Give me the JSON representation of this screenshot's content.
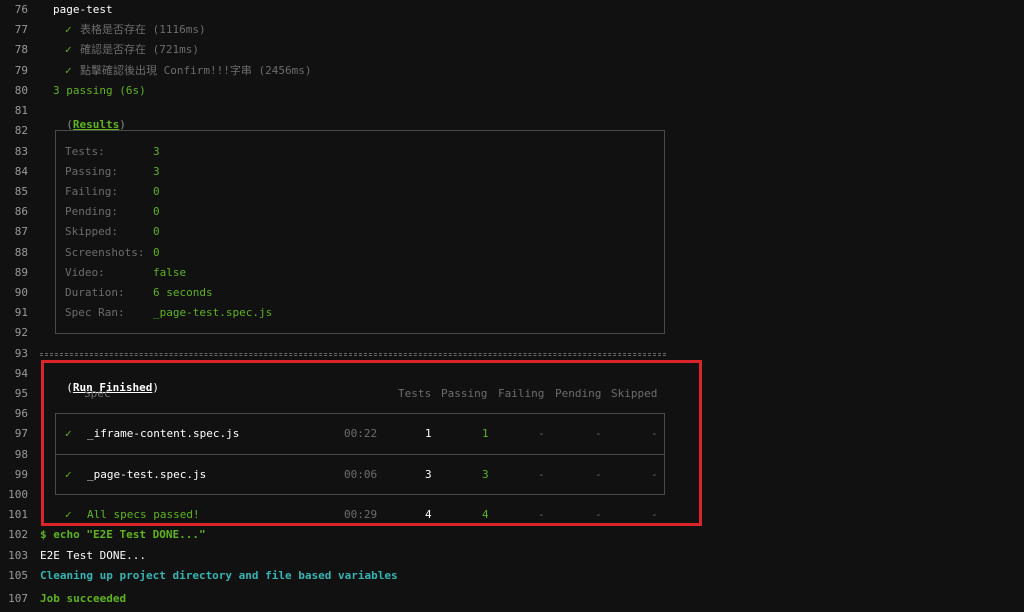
{
  "lines": {
    "76": {
      "num": "76",
      "text": "page-test"
    },
    "77": {
      "num": "77",
      "check": "✓",
      "text": "表格是否存在 (1116ms)"
    },
    "78": {
      "num": "78",
      "check": "✓",
      "text": "確認是否存在 (721ms)"
    },
    "79": {
      "num": "79",
      "check": "✓",
      "text": "點擊確認後出現 Confirm!!!字串 (2456ms)"
    },
    "80": {
      "num": "80",
      "text": "3 passing (6s)"
    },
    "81": {
      "num": "81",
      "text_open": "(",
      "text": "Results",
      "text_close": ")"
    },
    "82": {
      "num": "82"
    },
    "83": {
      "num": "83",
      "label": "Tests:",
      "value": "3"
    },
    "84": {
      "num": "84",
      "label": "Passing:",
      "value": "3"
    },
    "85": {
      "num": "85",
      "label": "Failing:",
      "value": "0"
    },
    "86": {
      "num": "86",
      "label": "Pending:",
      "value": "0"
    },
    "87": {
      "num": "87",
      "label": "Skipped:",
      "value": "0"
    },
    "88": {
      "num": "88",
      "label": "Screenshots:",
      "value": "0"
    },
    "89": {
      "num": "89",
      "label": "Video:",
      "value": "false"
    },
    "90": {
      "num": "90",
      "label": "Duration:",
      "value": "6 seconds"
    },
    "91": {
      "num": "91",
      "label": "Spec Ran:",
      "value": "_page-test.spec.js"
    },
    "92": {
      "num": "92"
    },
    "93": {
      "num": "93"
    },
    "94": {
      "num": "94",
      "text_open": "(",
      "text": "Run Finished",
      "text_close": ")"
    },
    "95": {
      "num": "95",
      "spec": "Spec",
      "tests": "Tests",
      "passing": "Passing",
      "failing": "Failing",
      "pending": "Pending",
      "skipped": "Skipped"
    },
    "96": {
      "num": "96"
    },
    "97": {
      "num": "97",
      "check": "✓",
      "spec": "_iframe-content.spec.js",
      "time": "00:22",
      "tests": "1",
      "passing": "1",
      "failing": "-",
      "pending": "-",
      "skipped": "-"
    },
    "98": {
      "num": "98"
    },
    "99": {
      "num": "99",
      "check": "✓",
      "spec": "_page-test.spec.js",
      "time": "00:06",
      "tests": "3",
      "passing": "3",
      "failing": "-",
      "pending": "-",
      "skipped": "-"
    },
    "100": {
      "num": "100"
    },
    "101": {
      "num": "101",
      "check": "✓",
      "spec": "All specs passed!",
      "time": "00:29",
      "tests": "4",
      "passing": "4",
      "failing": "-",
      "pending": "-",
      "skipped": "-"
    },
    "102": {
      "num": "102",
      "text": "$ echo \"E2E Test DONE...\""
    },
    "103": {
      "num": "103",
      "text": "E2E Test DONE..."
    },
    "105": {
      "num": "105",
      "text": "Cleaning up project directory and file based variables"
    },
    "107": {
      "num": "107",
      "text": "Job succeeded"
    }
  }
}
